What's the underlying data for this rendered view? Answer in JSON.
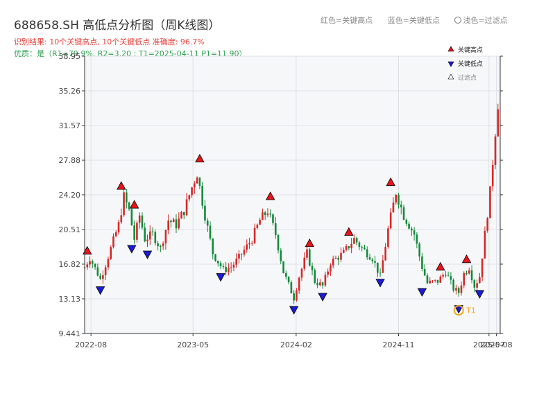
{
  "header": {
    "title": "688658.SH 高低点分析图（周K线图）",
    "result_text": "识别结果: 10个关键高点, 10个关键低点   准确度: 96.7%",
    "quality_text": "优质：是（R1=79.9%, R2=3.20 ; T1=2025-04-11 P1=11.90）",
    "legend_high": "红色=关键高点",
    "legend_low": "蓝色=关键低点",
    "legend_filtered": "浅色=过滤点"
  },
  "colors": {
    "up": "#d62728",
    "down": "#138a3a",
    "high_marker": "#e8141b",
    "low_marker": "#1b1bd6",
    "t1": "#f5a623",
    "plot_bg": "#f6f7f9",
    "grid": "#dde1e6"
  },
  "chart_data": {
    "type": "candlestick",
    "yaxis": {
      "min": 9.441,
      "max": 38.95,
      "ticks": [
        9.441,
        13.13,
        16.82,
        20.51,
        24.2,
        27.88,
        31.57,
        35.26,
        38.95
      ],
      "tick_labels": [
        "9.441",
        "13.13",
        "16.82",
        "20.51",
        "24.20",
        "27.88",
        "31.57",
        "35.26",
        "38.95"
      ]
    },
    "xaxis": {
      "start": "2022-07-15",
      "end": "2025-07-31",
      "ticks": [
        "2022-08-01",
        "2023-05-01",
        "2024-02-01",
        "2024-11-01",
        "2025-07-01",
        "2025-07-21"
      ],
      "tick_labels": [
        "2022-08",
        "2023-05",
        "2024-02",
        "2024-11",
        "2025-07",
        "2025-08"
      ]
    },
    "close_anchors": [
      [
        "2022-07-15",
        16.5
      ],
      [
        "2022-07-29",
        17.5
      ],
      [
        "2022-08-19",
        15.8
      ],
      [
        "2022-08-26",
        15.2
      ],
      [
        "2022-09-09",
        16.8
      ],
      [
        "2022-10-14",
        21.0
      ],
      [
        "2022-10-28",
        24.0
      ],
      [
        "2022-11-11",
        22.5
      ],
      [
        "2022-11-25",
        19.5
      ],
      [
        "2022-12-09",
        22.0
      ],
      [
        "2022-12-23",
        19.5
      ],
      [
        "2023-01-13",
        20.0
      ],
      [
        "2023-02-03",
        18.5
      ],
      [
        "2023-02-24",
        21.5
      ],
      [
        "2023-03-17",
        21.0
      ],
      [
        "2023-04-07",
        22.5
      ],
      [
        "2023-04-28",
        25.0
      ],
      [
        "2023-05-12",
        26.5
      ],
      [
        "2023-06-02",
        22.0
      ],
      [
        "2023-06-23",
        18.0
      ],
      [
        "2023-07-21",
        16.2
      ],
      [
        "2023-08-11",
        16.5
      ],
      [
        "2023-09-01",
        17.5
      ],
      [
        "2023-10-06",
        19.5
      ],
      [
        "2023-10-27",
        21.5
      ],
      [
        "2023-11-17",
        22.5
      ],
      [
        "2023-12-08",
        20.0
      ],
      [
        "2023-12-29",
        16.0
      ],
      [
        "2024-01-26",
        13.2
      ],
      [
        "2024-02-09",
        15.5
      ],
      [
        "2024-03-01",
        18.0
      ],
      [
        "2024-03-22",
        15.0
      ],
      [
        "2024-04-12",
        14.5
      ],
      [
        "2024-05-03",
        17.0
      ],
      [
        "2024-06-07",
        18.0
      ],
      [
        "2024-07-05",
        19.5
      ],
      [
        "2024-07-26",
        18.5
      ],
      [
        "2024-08-23",
        17.5
      ],
      [
        "2024-09-13",
        15.5
      ],
      [
        "2024-10-04",
        20.5
      ],
      [
        "2024-10-25",
        24.5
      ],
      [
        "2024-11-15",
        22.0
      ],
      [
        "2024-12-13",
        20.0
      ],
      [
        "2025-01-03",
        16.5
      ],
      [
        "2025-01-17",
        14.8
      ],
      [
        "2025-02-14",
        15.0
      ],
      [
        "2025-03-07",
        16.0
      ],
      [
        "2025-03-28",
        14.2
      ],
      [
        "2025-04-11",
        13.8
      ],
      [
        "2025-04-25",
        15.8
      ],
      [
        "2025-05-09",
        16.5
      ],
      [
        "2025-05-23",
        14.5
      ],
      [
        "2025-06-06",
        15.5
      ],
      [
        "2025-06-20",
        20.0
      ],
      [
        "2025-07-04",
        24.5
      ],
      [
        "2025-07-18",
        31.0
      ],
      [
        "2025-07-25",
        34.0
      ]
    ],
    "key_highs": [
      {
        "date": "2022-07-22",
        "price": 18.1
      },
      {
        "date": "2022-10-21",
        "price": 25.0
      },
      {
        "date": "2022-11-25",
        "price": 23.0
      },
      {
        "date": "2023-05-19",
        "price": 27.9
      },
      {
        "date": "2023-11-24",
        "price": 23.9
      },
      {
        "date": "2024-03-08",
        "price": 18.9
      },
      {
        "date": "2024-06-21",
        "price": 20.1
      },
      {
        "date": "2024-10-11",
        "price": 25.4
      },
      {
        "date": "2025-02-21",
        "price": 16.4
      },
      {
        "date": "2025-05-02",
        "price": 17.2
      }
    ],
    "key_lows": [
      {
        "date": "2022-08-26",
        "price": 14.2
      },
      {
        "date": "2022-11-18",
        "price": 18.6
      },
      {
        "date": "2022-12-30",
        "price": 18.0
      },
      {
        "date": "2023-07-14",
        "price": 15.6
      },
      {
        "date": "2024-01-26",
        "price": 12.1
      },
      {
        "date": "2024-04-12",
        "price": 13.5
      },
      {
        "date": "2024-09-13",
        "price": 15.0
      },
      {
        "date": "2025-01-03",
        "price": 14.0
      },
      {
        "date": "2025-04-11",
        "price": 12.2
      },
      {
        "date": "2025-06-06",
        "price": 13.8
      }
    ],
    "t1": {
      "date": "2025-04-11",
      "price": 11.9,
      "label": "T1"
    },
    "legend": {
      "items": [
        "关键高点",
        "关键低点",
        "过滤点"
      ],
      "placement": "top-right"
    },
    "grid": true
  }
}
